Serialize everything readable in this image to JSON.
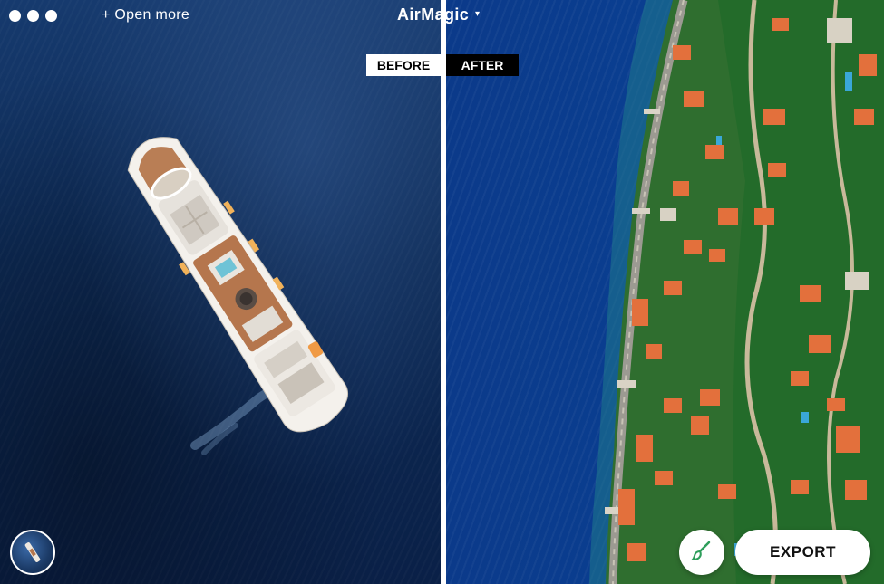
{
  "window": {
    "open_more_label": "+ Open more",
    "app_title": "AirMagic",
    "title_caret": "▾"
  },
  "compare": {
    "before_label": "BEFORE",
    "after_label": "AFTER"
  },
  "toolbar": {
    "export_label": "EXPORT",
    "brush_icon": "brush-icon"
  },
  "colors": {
    "accent_green": "#2e9e5b",
    "roof_orange": "#e3703c",
    "sea_blue": "#0b3a8a"
  }
}
